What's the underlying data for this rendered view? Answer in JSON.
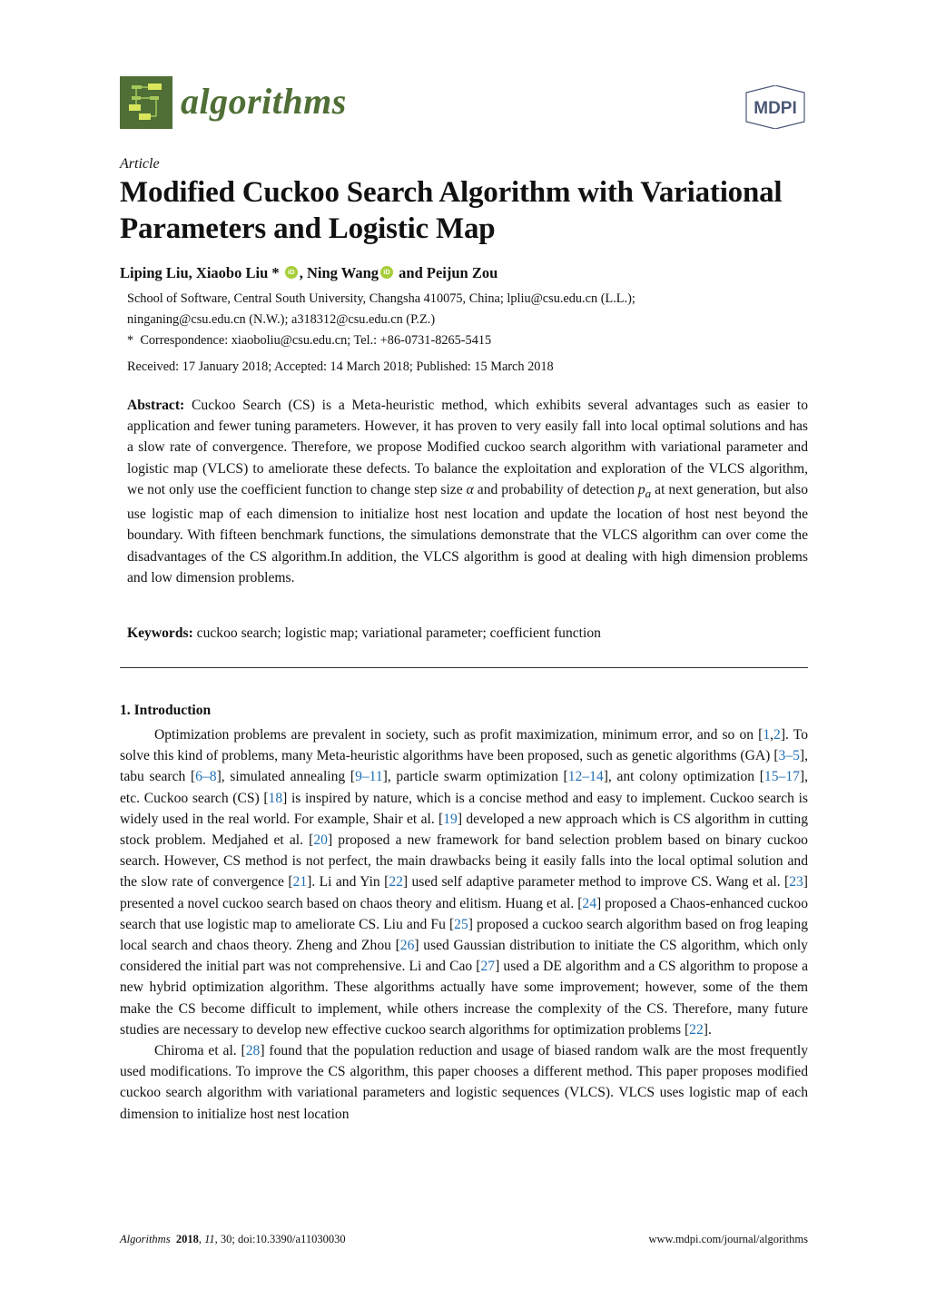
{
  "header": {
    "journal_name": "algorithms",
    "publisher": "MDPI",
    "brand_color": "#4f6f36",
    "publisher_color": "#4b5876"
  },
  "article": {
    "type": "Article",
    "title": "Modified Cuckoo Search Algorithm with Variational Parameters and Logistic Map",
    "authors": [
      {
        "name": "Liping Liu",
        "sep": ", "
      },
      {
        "name": "Xiaobo Liu",
        "mark": " *",
        "orcid": true,
        "sep": ", "
      },
      {
        "name": "Ning Wang",
        "orcid": true,
        "sep": " and "
      },
      {
        "name": "Peijun Zou",
        "sep": ""
      }
    ],
    "orcid_label": "iD",
    "affiliation_line1": "School of Software, Central South University, Changsha 410075, China; lpliu@csu.edu.cn (L.L.);",
    "affiliation_line2": "ninganing@csu.edu.cn (N.W.); a318312@csu.edu.cn (P.Z.)",
    "correspondence_mark": "*",
    "correspondence": "Correspondence: xiaoboliu@csu.edu.cn; Tel.: +86-0731-8265-5415",
    "dates": "Received: 17 January 2018; Accepted: 14 March 2018; Published: 15 March 2018"
  },
  "abstract": {
    "label": "Abstract:",
    "text_1": " Cuckoo Search (CS) is a Meta-heuristic method, which exhibits several advantages such as easier to application and fewer tuning parameters. However, it has proven to very easily fall into local optimal solutions and has a slow rate of convergence. Therefore, we propose Modified cuckoo search algorithm with variational parameter and logistic map (VLCS) to ameliorate these defects. To balance the exploitation and exploration of the VLCS algorithm, we not only use the coefficient function to change step size ",
    "alpha": "α",
    "text_2": " and probability of detection ",
    "pa_base": "p",
    "pa_sub": "a",
    "text_3": " at next generation, but also use logistic map of each dimension to initialize host nest location and update the location of host nest beyond the boundary. With fifteen benchmark functions, the simulations demonstrate that the VLCS algorithm can over come the disadvantages of the CS algorithm.In addition, the VLCS algorithm is good at dealing with high dimension problems and low dimension problems."
  },
  "keywords": {
    "label": "Keywords:",
    "text": " cuckoo search; logistic map; variational parameter; coefficient function"
  },
  "introduction": {
    "heading": "1. Introduction",
    "p1": [
      {
        "t": "Optimization problems are prevalent in society, such as profit maximization, minimum error, and so on ["
      },
      {
        "c": "1"
      },
      {
        "t": ","
      },
      {
        "c": "2"
      },
      {
        "t": "]. To solve this kind of problems, many Meta-heuristic algorithms have been proposed, such as genetic algorithms (GA) ["
      },
      {
        "c": "3–5"
      },
      {
        "t": "], tabu search ["
      },
      {
        "c": "6–8"
      },
      {
        "t": "], simulated annealing ["
      },
      {
        "c": "9–11"
      },
      {
        "t": "], particle swarm optimization ["
      },
      {
        "c": "12–14"
      },
      {
        "t": "], ant colony optimization ["
      },
      {
        "c": "15–17"
      },
      {
        "t": "], etc.  Cuckoo search (CS) ["
      },
      {
        "c": "18"
      },
      {
        "t": "] is inspired by nature, which is a concise method and easy to implement. Cuckoo search is widely used in the real world.  For example, Shair et al. ["
      },
      {
        "c": "19"
      },
      {
        "t": "] developed a new approach which is CS algorithm in cutting stock problem. Medjahed et al. ["
      },
      {
        "c": "20"
      },
      {
        "t": "] proposed a new framework for band selection problem based on binary cuckoo search. However, CS method is not perfect, the main drawbacks being it easily falls into the local optimal solution and the slow rate of convergence ["
      },
      {
        "c": "21"
      },
      {
        "t": "]. Li and Yin ["
      },
      {
        "c": "22"
      },
      {
        "t": "] used self adaptive parameter method to improve CS. Wang et al. ["
      },
      {
        "c": "23"
      },
      {
        "t": "] presented a novel cuckoo search based on chaos theory and elitism. Huang et al. ["
      },
      {
        "c": "24"
      },
      {
        "t": "] proposed a Chaos-enhanced cuckoo search that use logistic map to ameliorate CS. Liu and Fu ["
      },
      {
        "c": "25"
      },
      {
        "t": "] proposed a cuckoo search algorithm based on frog leaping local search and chaos theory. Zheng and Zhou ["
      },
      {
        "c": "26"
      },
      {
        "t": "] used Gaussian distribution to initiate the CS algorithm, which only considered the initial part was not comprehensive. Li and Cao ["
      },
      {
        "c": "27"
      },
      {
        "t": "] used a DE algorithm and a CS algorithm to propose a new hybrid optimization algorithm. These algorithms actually have some improvement; however, some of the them make the CS become difficult to implement, while others increase the complexity of the CS. Therefore, many future studies are necessary to develop new effective cuckoo search algorithms for optimization problems ["
      },
      {
        "c": "22"
      },
      {
        "t": "]."
      }
    ],
    "p2": [
      {
        "t": "Chiroma et al. ["
      },
      {
        "c": "28"
      },
      {
        "t": "] found that the population reduction and usage of biased random walk are the most frequently used modifications. To improve the CS algorithm, this paper chooses a different method.  This paper proposes modified cuckoo search algorithm with variational parameters and logistic sequences (VLCS). VLCS uses logistic map of each dimension to initialize host nest location"
      }
    ],
    "citation_color": "#1f6fb3"
  },
  "footer": {
    "journal": "Algorithms",
    "year": "2018",
    "volume": "11",
    "rest": ", 30; doi:10.3390/a11030030",
    "url": "www.mdpi.com/journal/algorithms"
  }
}
